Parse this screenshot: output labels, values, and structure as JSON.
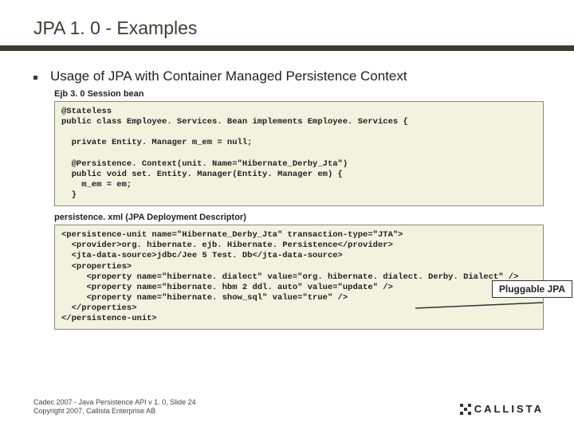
{
  "title": "JPA 1. 0 - Examples",
  "bullet": "Usage of JPA with Container Managed Persistence Context",
  "label1": "Ejb 3. 0 Session bean",
  "code1": "@Stateless\npublic class Employee. Services. Bean implements Employee. Services {\n\n  private Entity. Manager m_em = null;\n\n  @Persistence. Context(unit. Name=\"Hibernate_Derby_Jta\")\n  public void set. Entity. Manager(Entity. Manager em) {\n    m_em = em;\n  }",
  "label2": "persistence. xml (JPA Deployment Descriptor)",
  "code2": "<persistence-unit name=\"Hibernate_Derby_Jta\" transaction-type=\"JTA\">\n  <provider>org. hibernate. ejb. Hibernate. Persistence</provider>\n  <jta-data-source>jdbc/Jee 5 Test. Db</jta-data-source>\n  <properties>\n     <property name=\"hibernate. dialect\" value=\"org. hibernate. dialect. Derby. Dialect\" />\n     <property name=\"hibernate. hbm 2 ddl. auto\" value=\"update\" />\n     <property name=\"hibernate. show_sql\" value=\"true\" />\n  </properties>\n</persistence-unit>",
  "callout": "Pluggable JPA",
  "footer1": "Cadec 2007 - Java Persistence API v 1. 0, Slide 24",
  "footer2": "Copyright 2007, Callista Enterprise AB",
  "logo": "CALLISTA"
}
